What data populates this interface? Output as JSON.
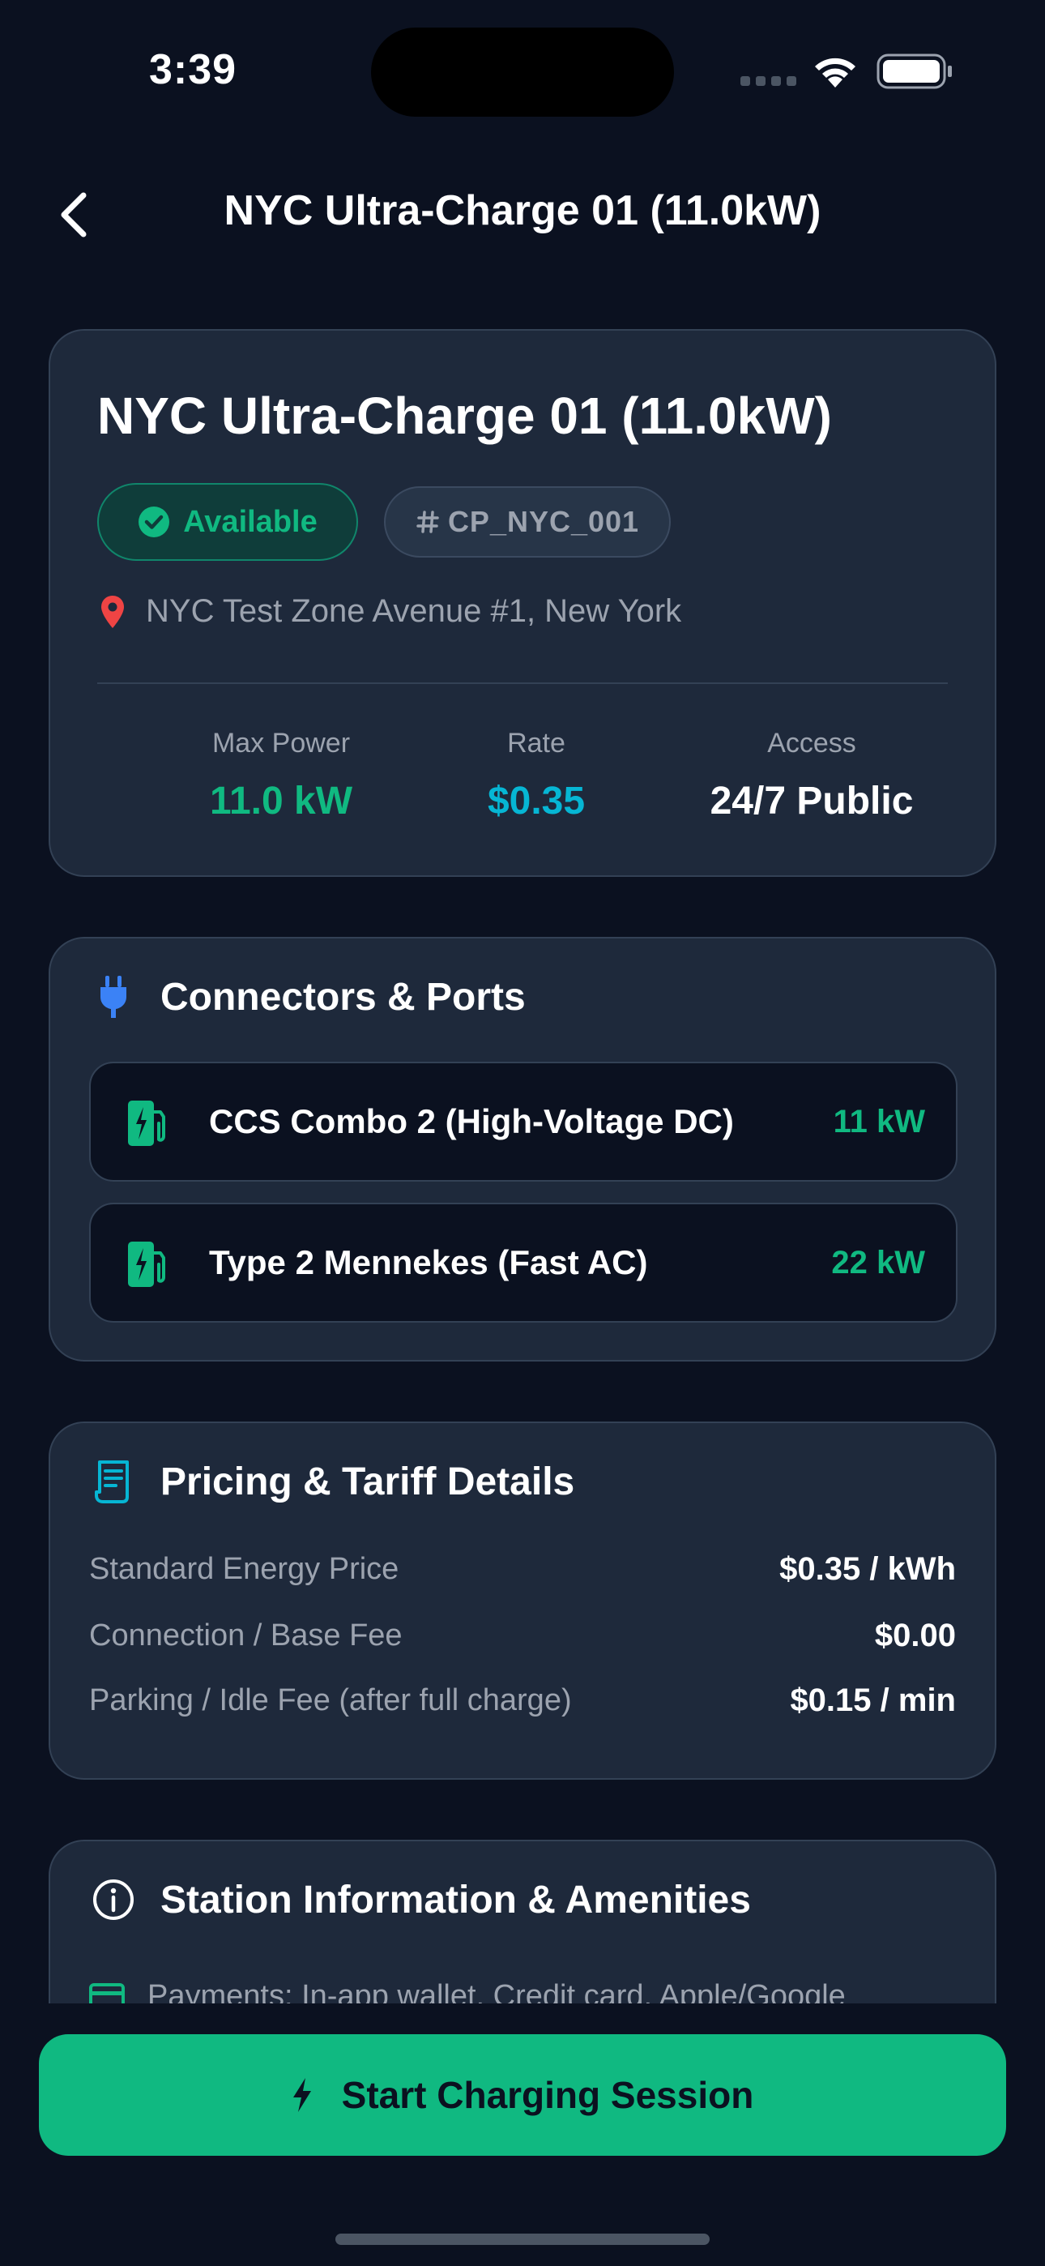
{
  "status_bar": {
    "time": "3:39"
  },
  "header": {
    "title": "NYC Ultra-Charge 01 (11.0kW)"
  },
  "station": {
    "name": "NYC Ultra-Charge 01 (11.0kW)",
    "status": "Available",
    "id": "CP_NYC_001",
    "address": "NYC Test Zone Avenue #1, New York",
    "stats": [
      {
        "label": "Max Power",
        "value": "11.0 kW"
      },
      {
        "label": "Rate",
        "value": "$0.35"
      },
      {
        "label": "Access",
        "value": "24/7 Public"
      }
    ]
  },
  "connectors": {
    "title": "Connectors & Ports",
    "items": [
      {
        "name": "CCS Combo 2 (High-Voltage DC)",
        "power": "11 kW"
      },
      {
        "name": "Type 2 Mennekes (Fast AC)",
        "power": "22 kW"
      }
    ]
  },
  "pricing": {
    "title": "Pricing & Tariff Details",
    "rows": [
      {
        "label": "Standard Energy Price",
        "value": "$0.35 / kWh"
      },
      {
        "label": "Connection / Base Fee",
        "value": "$0.00"
      },
      {
        "label": "Parking / Idle Fee (after full charge)",
        "value": "$0.15 / min"
      }
    ]
  },
  "info": {
    "title": "Station Information & Amenities",
    "payments": "Payments: In-app wallet, Credit card, Apple/Google"
  },
  "cta": {
    "label": "Start Charging Session"
  },
  "colors": {
    "background": "#0b1120",
    "card": "#1e293b",
    "accent_green": "#10b981",
    "accent_cyan": "#06b6d4",
    "accent_blue": "#3b82f6",
    "pin_red": "#ef4444"
  },
  "icons": [
    "back-chevron-icon",
    "check-circle-icon",
    "hash-icon",
    "location-pin-icon",
    "plug-icon",
    "ev-station-icon",
    "receipt-icon",
    "info-icon",
    "credit-card-icon",
    "bolt-icon",
    "wifi-icon",
    "battery-icon"
  ]
}
